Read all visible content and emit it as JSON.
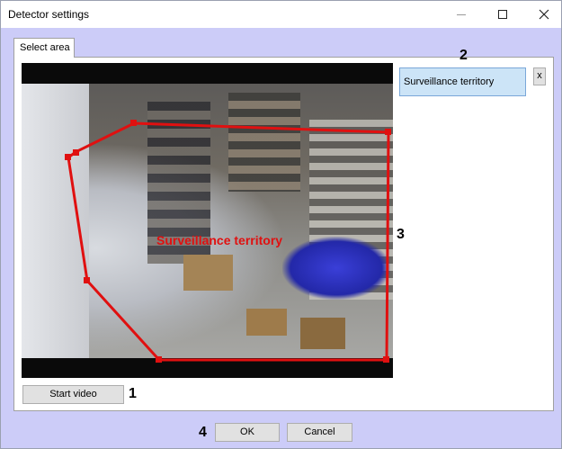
{
  "window": {
    "title": "Detector settings",
    "controls": {
      "minimize": "minimize-icon",
      "maximize": "maximize-icon",
      "close": "close-icon"
    }
  },
  "tabs": [
    {
      "label": "Select area",
      "active": true
    }
  ],
  "video": {
    "zone_label": "Surveillance territory",
    "zone_color": "#e01010"
  },
  "areas": {
    "items": [
      {
        "label": "Surveillance territory",
        "selected": true
      }
    ],
    "delete_label": "x"
  },
  "buttons": {
    "start_video": "Start video",
    "ok": "OK",
    "cancel": "Cancel"
  },
  "callouts": [
    "1",
    "2",
    "3",
    "4"
  ]
}
